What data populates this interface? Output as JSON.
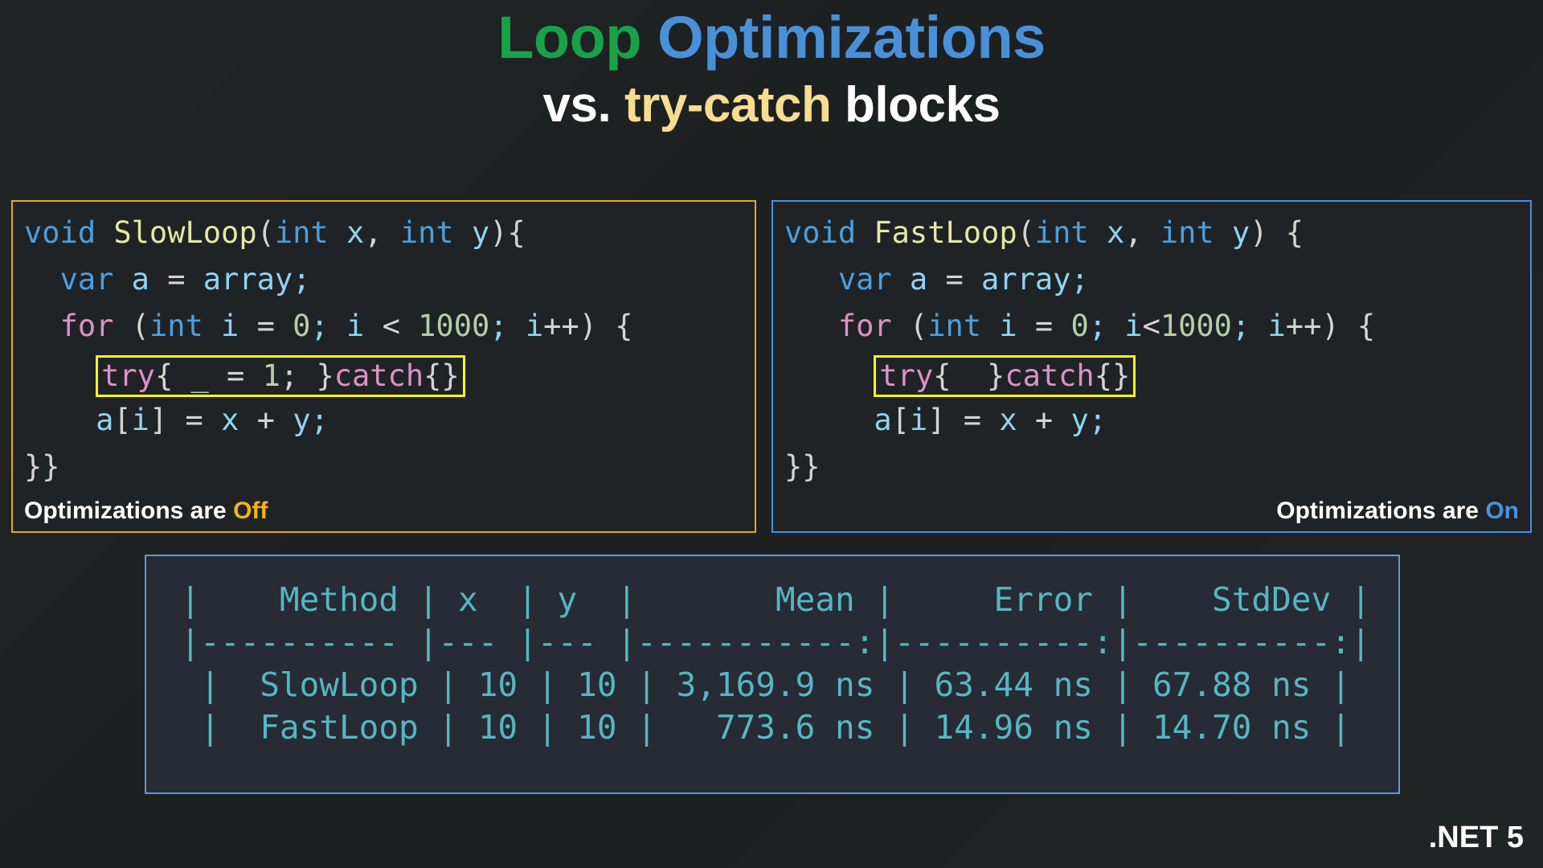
{
  "background_color": "#1d2021",
  "title": {
    "line1_part1": "Loop ",
    "line1_part2": "Optimizations",
    "line2_part1": "vs. ",
    "line2_part2": "try-catch",
    "line2_part3": " blocks",
    "color_loop": "#17a24a",
    "color_optimizations": "#4a90d9",
    "color_trycatch": "#f7dd92",
    "color_plain": "#ffffff"
  },
  "panels": {
    "left": {
      "border_color": "#e0a92a",
      "status_prefix": "Optimizations are ",
      "status_value": "Off",
      "status_value_color": "#f5b316",
      "code": {
        "line1": {
          "kw_void": "void",
          "fn_name": " SlowLoop",
          "p_open": "(",
          "kw_int1": "int",
          "id_x": " x",
          "comma": ", ",
          "kw_int2": "int",
          "id_y": " y",
          "tail": "){"
        },
        "line2": {
          "indent": "  ",
          "kw_var": "var",
          "id_a": " a ",
          "eq": "= ",
          "id_array": "array",
          "semi": ";"
        },
        "line3": {
          "indent": "  ",
          "ctl_for": "for",
          "p_open": " (",
          "kw_int": "int",
          "id_i": " i ",
          "eq1": "= ",
          "num_0": "0",
          "semi1": "; ",
          "id_i2": "i ",
          "lt": "< ",
          "num_1000": "1000",
          "semi2": "; ",
          "id_i3": "i",
          "inc": "++) {"
        },
        "line4_highlight": {
          "indent": "    ",
          "ctl_try": "try",
          "brace_open": "{ ",
          "num_underscore": "_",
          "eq": " = ",
          "num_1": "1",
          "semi": "; ",
          "brace_close": "}",
          "ctl_catch": "catch",
          "empty": "{}"
        },
        "line5": {
          "indent": "    ",
          "id_a": "a",
          "br_open": "[",
          "id_i": "i",
          "br_close": "] ",
          "eq": "= ",
          "id_x": "x ",
          "plus": "+ ",
          "id_y": "y",
          "semi": ";"
        },
        "line6": "}}"
      }
    },
    "right": {
      "border_color": "#4a90d9",
      "status_prefix": "Optimizations are ",
      "status_value": "On",
      "status_value_color": "#4a90d9",
      "code": {
        "line1": {
          "kw_void": "void",
          "fn_name": " FastLoop",
          "p_open": "(",
          "kw_int1": "int",
          "id_x": " x",
          "comma": ", ",
          "kw_int2": "int",
          "id_y": " y",
          "tail": ") {"
        },
        "line2": {
          "indent": "   ",
          "kw_var": "var",
          "id_a": " a ",
          "eq": "= ",
          "id_array": "array",
          "semi": ";"
        },
        "line3": {
          "indent": "   ",
          "ctl_for": "for",
          "p_open": " (",
          "kw_int": "int",
          "id_i": " i ",
          "eq1": "= ",
          "num_0": "0",
          "semi1": "; ",
          "id_i2": "i",
          "lt": "<",
          "num_1000": "1000",
          "semi2": "; ",
          "id_i3": "i",
          "inc": "++) {"
        },
        "line4_highlight": {
          "indent": "     ",
          "ctl_try": "try",
          "brace_open": "{  ",
          "brace_close": "}",
          "ctl_catch": "catch",
          "empty": "{}"
        },
        "line5": {
          "indent": "     ",
          "id_a": "a",
          "br_open": "[",
          "id_i": "i",
          "br_close": "] ",
          "eq": "= ",
          "id_x": "x ",
          "plus": "+ ",
          "id_y": "y",
          "semi": ";"
        },
        "line6": "}}"
      }
    }
  },
  "results_table": {
    "border_color": "#5b9bd5",
    "text_color": "#56b6c2",
    "columns": [
      "Method",
      "x",
      "y",
      "Mean",
      "Error",
      "StdDev"
    ],
    "header_row": "|    Method | x  | y  |       Mean |     Error |    StdDev |",
    "separator_row": "|---------- |--- |--- |-----------:|----------:|----------:|",
    "rows": [
      {
        "Method": "SlowLoop",
        "x": "10",
        "y": "10",
        "Mean": "3,169.9 ns",
        "Error": "63.44 ns",
        "StdDev": "67.88 ns",
        "line": "|  SlowLoop | 10 | 10 | 3,169.9 ns | 63.44 ns | 67.88 ns |"
      },
      {
        "Method": "FastLoop",
        "x": "10",
        "y": "10",
        "Mean": "773.6 ns",
        "Error": "14.96 ns",
        "StdDev": "14.70 ns",
        "line": "|  FastLoop | 10 | 10 |   773.6 ns | 14.96 ns | 14.70 ns |"
      }
    ]
  },
  "footer": {
    "brand": ".NET 5"
  }
}
